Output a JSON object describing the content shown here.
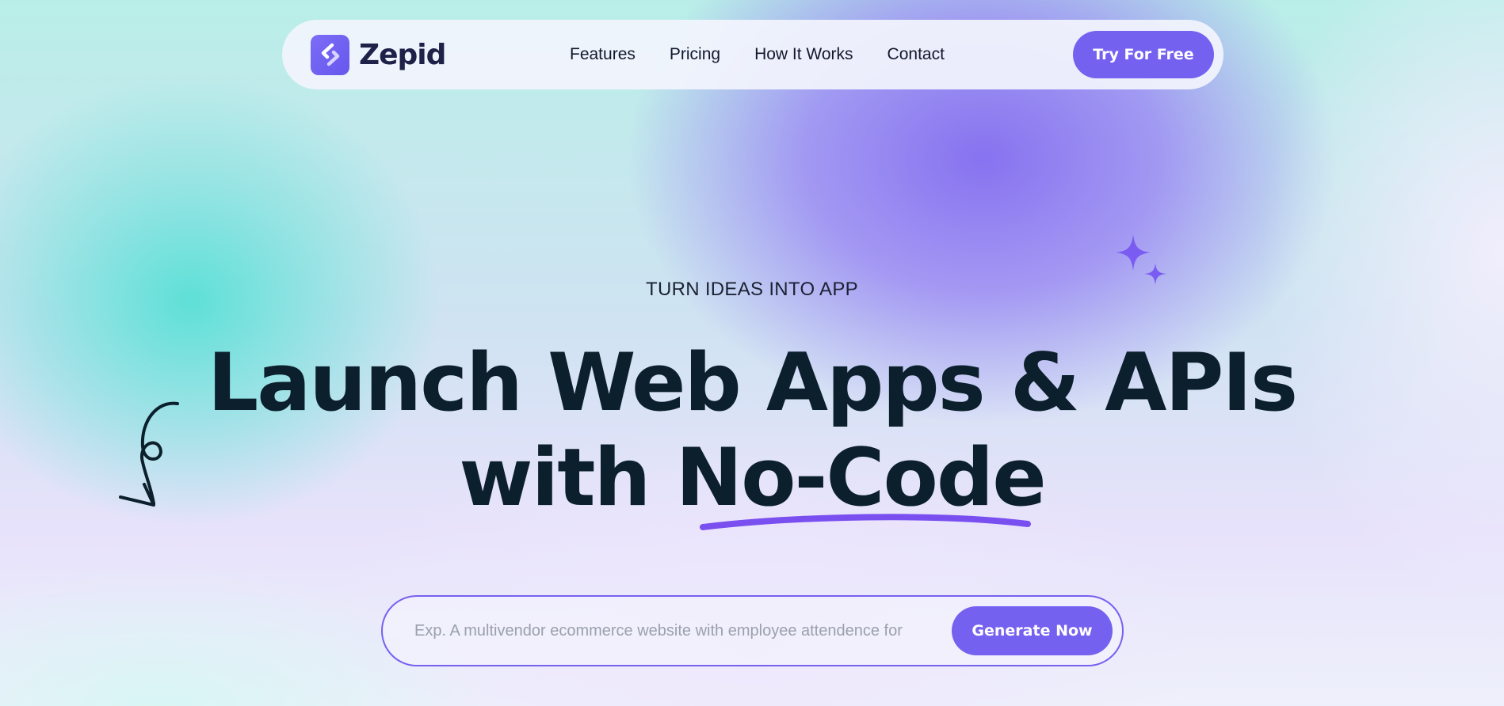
{
  "nav": {
    "brand": "Zepid",
    "links": [
      "Features",
      "Pricing",
      "How It Works",
      "Contact"
    ],
    "cta_label": "Try For Free"
  },
  "hero": {
    "eyebrow": "TURN IDEAS INTO APP",
    "headline_line1": "Launch Web Apps & APIs",
    "headline_line2_prefix": "with ",
    "headline_line2_highlight": "No-Code"
  },
  "prompt": {
    "placeholder": "Exp. A multivendor ecommerce website with employee attendence for",
    "value": "",
    "button_label": "Generate Now"
  },
  "colors": {
    "accent": "#7561f0",
    "headline": "#0b1f2c",
    "brand_text": "#1e2148",
    "teal_glow": "#58e0d6",
    "violet_glow": "#846cf0"
  },
  "icons": {
    "logo": "zepid-logo-icon",
    "sparkles": "sparkles-icon",
    "arrow": "curly-arrow-icon"
  }
}
